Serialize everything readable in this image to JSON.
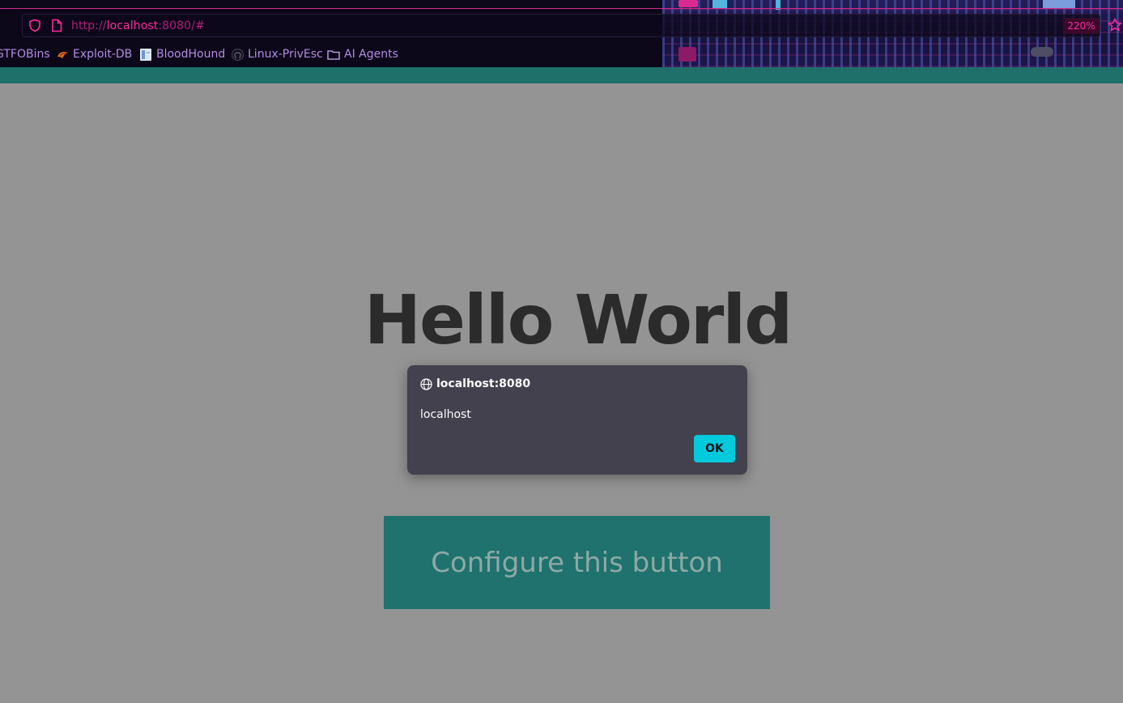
{
  "browser": {
    "url_prefix": "http://",
    "url_host": "localhost",
    "url_suffix": ":8080/#",
    "zoom": "220%",
    "bookmarks": [
      {
        "label": "GTFOBins",
        "icon": "none"
      },
      {
        "label": "Exploit-DB",
        "icon": "exploitdb-icon"
      },
      {
        "label": "BloodHound",
        "icon": "bloodhound-icon"
      },
      {
        "label": "Linux-PrivEsc",
        "icon": "github-icon"
      },
      {
        "label": "AI Agents",
        "icon": "folder-icon"
      }
    ],
    "accent_color": "#ff2a9d"
  },
  "page": {
    "heading": "Hello World",
    "button_label": "Configure this button",
    "topbar_color": "#1f6f6b"
  },
  "dialog": {
    "title": "localhost:8080",
    "message": "localhost",
    "ok_label": "OK",
    "ok_color": "#00cadb"
  }
}
